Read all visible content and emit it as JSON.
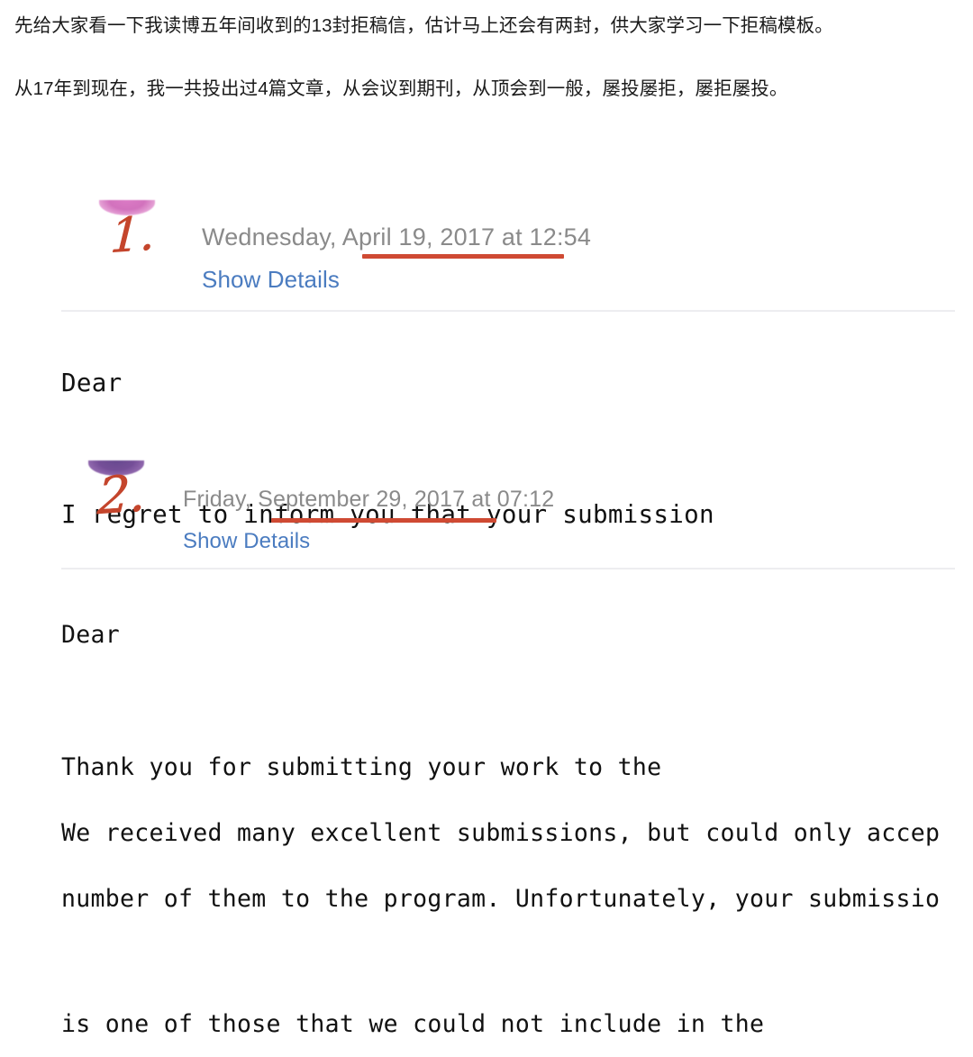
{
  "article": {
    "paragraph_1": "先给大家看一下我读博五年间收到的13封拒稿信，估计马上还会有两封，供大家学习一下拒稿模板。",
    "paragraph_2": "从17年到现在，我一共投出过4篇文章，从会议到期刊，从顶会到一般，屡投屡拒，屡拒屡投。"
  },
  "colors": {
    "accent_red": "#cf4a33",
    "handwriting_red": "#c4452c",
    "link_blue": "#4b7cc0",
    "date_gray": "#8a8a8a",
    "divider_gray": "#ededf0",
    "crescent_1_pink": "#cf67b8",
    "crescent_2_purple": "#6a4090",
    "body_text": "#111111",
    "article_text": "#1a1a1a",
    "background": "#ffffff"
  },
  "mails": [
    {
      "marker_numeral": "1.",
      "marker_crescent_icon": "crescent-highlight-icon",
      "date": "Wednesday, April 19, 2017 at 12:54",
      "show_details_label": "Show Details",
      "underline_covers": "April 19, 2017",
      "body_lines": [
        "Dear",
        "",
        "I regret to inform you that your submission"
      ]
    },
    {
      "marker_numeral": "2.",
      "marker_crescent_icon": "crescent-highlight-icon",
      "date": "Friday, September 29, 2017 at 07:12",
      "show_details_label": "Show Details",
      "underline_covers": "September 29, 2017",
      "body_lines": [
        "Dear",
        "",
        "Thank you for submitting your work to the",
        "We received many excellent submissions, but could only accep",
        "number of them to the program. Unfortunately, your submissio",
        "",
        "is one of those that we could not include in the"
      ]
    }
  ]
}
